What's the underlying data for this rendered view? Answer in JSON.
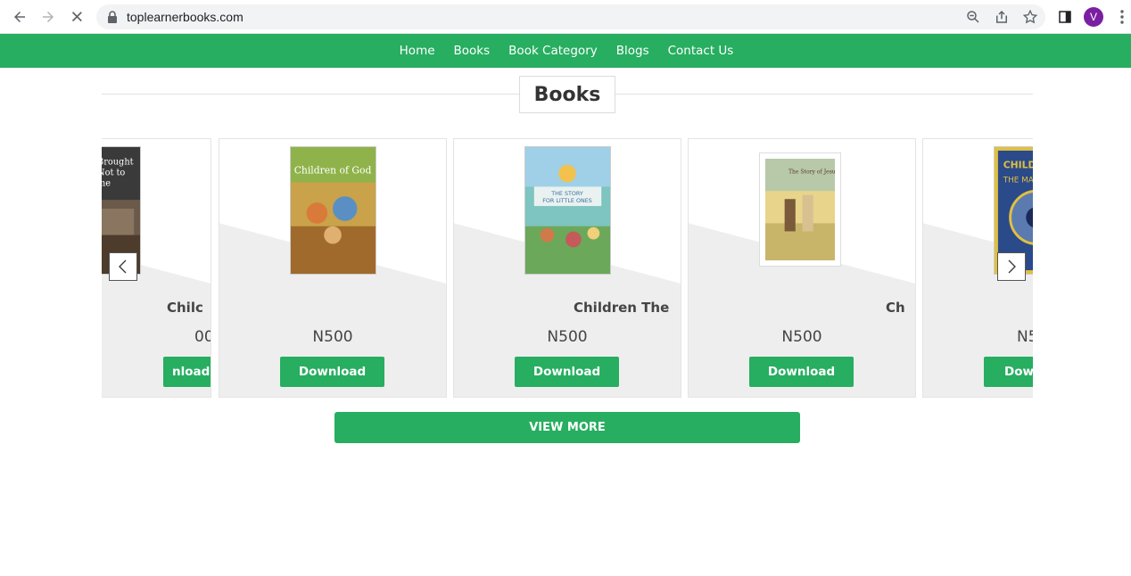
{
  "browser": {
    "url": "toplearnerbooks.com",
    "avatar_letter": "V",
    "icons": [
      "back-icon",
      "forward-icon",
      "stop-icon",
      "lock-icon",
      "zoom-icon",
      "share-icon",
      "star-icon",
      "side-panel-icon",
      "menu-icon"
    ]
  },
  "nav": {
    "items": [
      "Home",
      "Books",
      "Book Category",
      "Blogs",
      "Contact Us"
    ]
  },
  "section": {
    "title": "Books"
  },
  "carousel": {
    "cards": [
      {
        "title": "Chilc",
        "price": "00",
        "button": "nload",
        "cover_text": "Brought Not to me"
      },
      {
        "title": "",
        "price": "N500",
        "button": "Download",
        "cover_text": "Children of God"
      },
      {
        "title": "Children The",
        "price": "N500",
        "button": "Download",
        "cover_text": "THE STORY FOR LITTLE ONES"
      },
      {
        "title": "Ch",
        "price": "N500",
        "button": "Download",
        "cover_text": "The Story of Jesus"
      },
      {
        "title": "",
        "price": "N5",
        "button": "Dow",
        "cover_text": "CHILDREN THE MARK"
      }
    ],
    "prev_icon": "chevron-left-icon",
    "next_icon": "chevron-right-icon"
  },
  "view_more": "VIEW MORE",
  "colors": {
    "brand_green": "#27ae60",
    "avatar_purple": "#7b1fa2"
  }
}
